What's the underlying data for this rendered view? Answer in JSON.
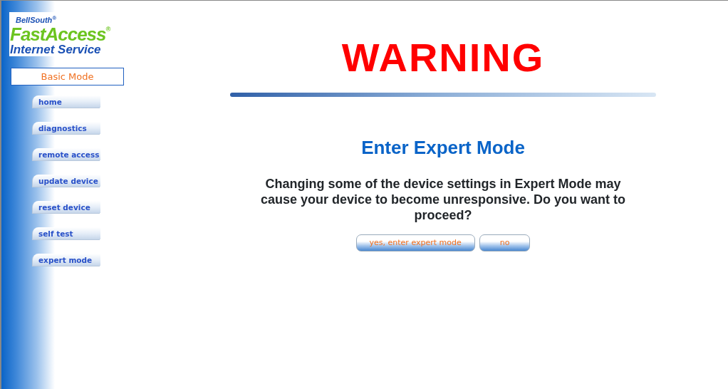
{
  "logo": {
    "company": "BellSouth$^{®}$",
    "product": "FastAccess$^{®}$",
    "service": "Internet Service"
  },
  "mode_label": "Basic Mode",
  "nav": [
    {
      "label": "home"
    },
    {
      "label": "diagnostics"
    },
    {
      "label": "remote access"
    },
    {
      "label": "update device"
    },
    {
      "label": "reset device"
    },
    {
      "label": "self test"
    },
    {
      "label": "expert mode"
    }
  ],
  "title": "WARNING",
  "subtitle": "Enter Expert Mode",
  "message": "Changing some of the device settings in Expert Mode may cause your device to become unresponsive. Do you want to proceed?",
  "buttons": [
    {
      "label": "yes, enter expert mode"
    },
    {
      "label": "no"
    }
  ]
}
